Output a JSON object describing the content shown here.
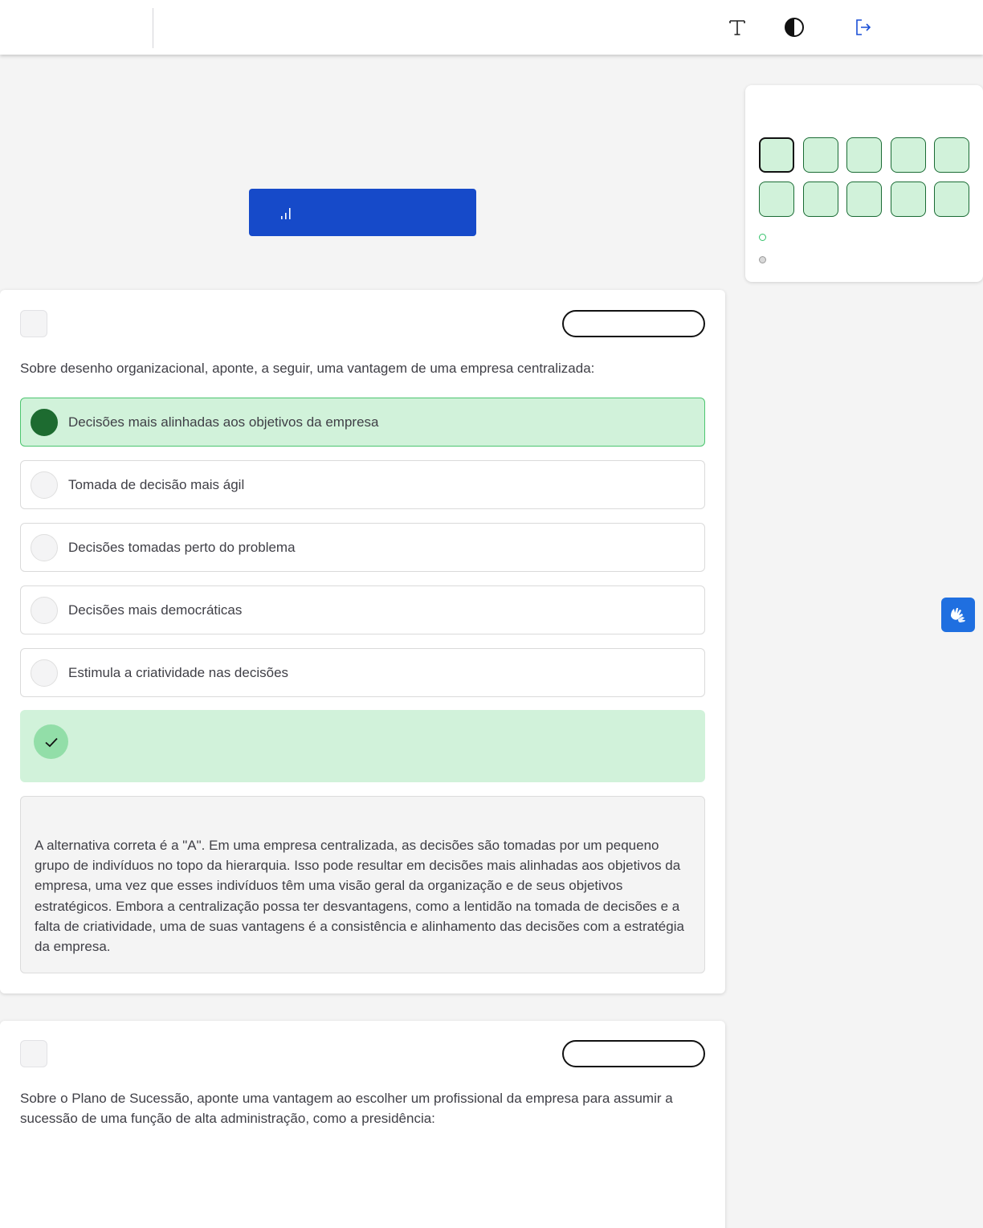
{
  "topbar": {
    "icons": [
      "font-size-icon",
      "contrast-icon",
      "logout-icon"
    ]
  },
  "performance_button": {
    "icon": "bar-chart-icon"
  },
  "question_nav": {
    "colors": {
      "answered": "#d1f2da",
      "border": "#1a6b34",
      "current_border": "#111111"
    },
    "current_index": 1,
    "total": 10
  },
  "question1": {
    "stem": "Sobre desenho organizacional, aponte, a seguir, uma vantagem de uma empresa centralizada:",
    "alternatives": [
      {
        "text": "Decisões mais alinhadas aos objetivos da empresa",
        "selected": true
      },
      {
        "text": "Tomada de decisão mais ágil",
        "selected": false
      },
      {
        "text": "Decisões tomadas perto do problema",
        "selected": false
      },
      {
        "text": "Decisões mais democráticas",
        "selected": false
      },
      {
        "text": "Estimula a criatividade nas decisões",
        "selected": false
      }
    ],
    "result_icon": "check-icon",
    "explanation": "A alternativa correta é a \"A\". Em uma empresa centralizada, as decisões são tomadas por um pequeno grupo de indivíduos no topo da hierarquia. Isso pode resultar em decisões mais alinhadas aos objetivos da empresa, uma vez que esses indivíduos têm uma visão geral da organização e de seus objetivos estratégicos. Embora a centralização possa ter desvantagens, como a lentidão na tomada de decisões e a falta de criatividade, uma de suas vantagens é a consistência e alinhamento das decisões com a estratégia da empresa."
  },
  "question2": {
    "stem": "Sobre o Plano de Sucessão, aponte uma vantagem ao escolher um profissional da empresa para assumir a sucessão de uma função de alta administração, como a presidência:"
  },
  "accessibility": {
    "icon": "sign-language-hands-icon",
    "color": "#1f6fe0"
  }
}
